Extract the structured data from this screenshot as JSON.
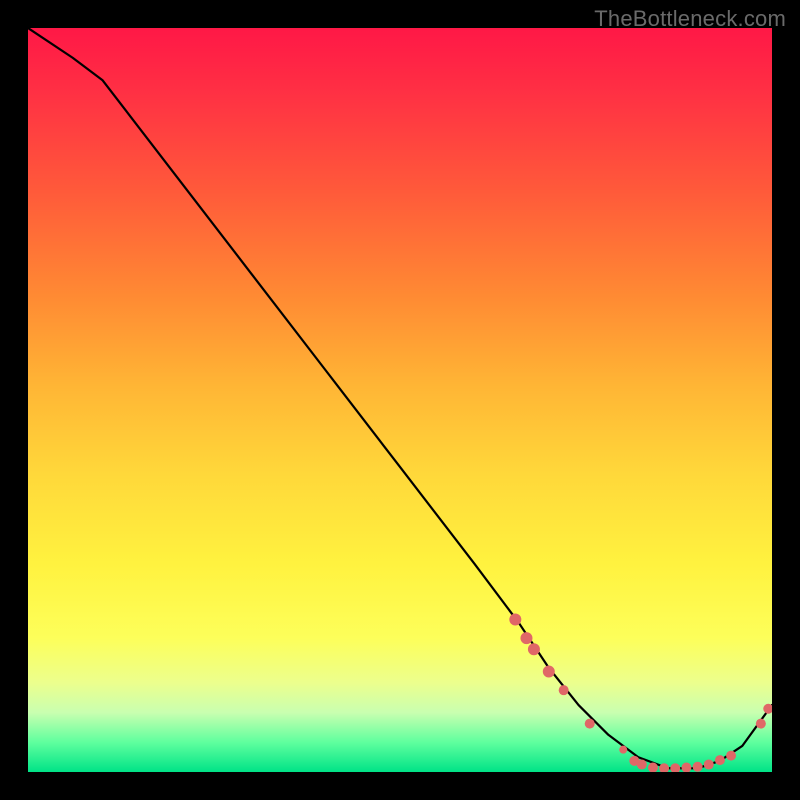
{
  "watermark": "TheBottleneck.com",
  "chart_data": {
    "type": "line",
    "title": "",
    "xlabel": "",
    "ylabel": "",
    "xlim": [
      0,
      100
    ],
    "ylim": [
      0,
      100
    ],
    "grid": false,
    "legend": false,
    "series": [
      {
        "name": "bottleneck-curve",
        "x": [
          0,
          6,
          10,
          20,
          30,
          40,
          50,
          60,
          66,
          70,
          74,
          78,
          82,
          86,
          90,
          93,
          96,
          100
        ],
        "values": [
          100,
          96,
          93,
          80,
          67,
          54,
          41,
          28,
          20,
          14,
          9,
          5,
          2,
          0.5,
          0.5,
          1.5,
          3.5,
          9
        ]
      }
    ],
    "markers": [
      {
        "x": 65.5,
        "y": 20.5,
        "r": 6
      },
      {
        "x": 67.0,
        "y": 18.0,
        "r": 6
      },
      {
        "x": 68.0,
        "y": 16.5,
        "r": 6
      },
      {
        "x": 70.0,
        "y": 13.5,
        "r": 6
      },
      {
        "x": 72.0,
        "y": 11.0,
        "r": 5
      },
      {
        "x": 75.5,
        "y": 6.5,
        "r": 5
      },
      {
        "x": 80.0,
        "y": 3.0,
        "r": 4
      },
      {
        "x": 81.5,
        "y": 1.5,
        "r": 5
      },
      {
        "x": 82.5,
        "y": 1.0,
        "r": 5
      },
      {
        "x": 84.0,
        "y": 0.6,
        "r": 5
      },
      {
        "x": 85.5,
        "y": 0.5,
        "r": 5
      },
      {
        "x": 87.0,
        "y": 0.5,
        "r": 5
      },
      {
        "x": 88.5,
        "y": 0.6,
        "r": 5
      },
      {
        "x": 90.0,
        "y": 0.7,
        "r": 5
      },
      {
        "x": 91.5,
        "y": 1.0,
        "r": 5
      },
      {
        "x": 93.0,
        "y": 1.6,
        "r": 5
      },
      {
        "x": 94.5,
        "y": 2.2,
        "r": 5
      },
      {
        "x": 98.5,
        "y": 6.5,
        "r": 5
      },
      {
        "x": 99.5,
        "y": 8.5,
        "r": 5
      }
    ],
    "colors": {
      "line": "#000000",
      "marker": "#e06767"
    }
  }
}
